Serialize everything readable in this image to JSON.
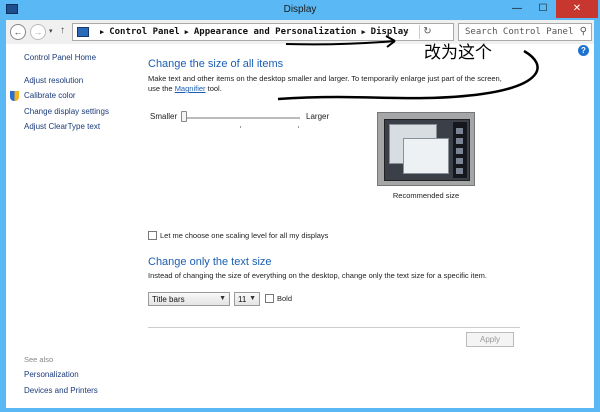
{
  "window": {
    "title": "Display"
  },
  "titlebar": {
    "minimize": "—",
    "maximize": "☐",
    "close": "✕"
  },
  "nav": {
    "back": "←",
    "forward": "→",
    "up": "↑",
    "crumbs": [
      "Control Panel",
      "Appearance and Personalization",
      "Display"
    ],
    "search_placeholder": "Search Control Panel"
  },
  "sidebar": {
    "home": "Control Panel Home",
    "items": [
      "Adjust resolution",
      "Calibrate color",
      "Change display settings",
      "Adjust ClearType text"
    ],
    "see_also_label": "See also",
    "see_also": [
      "Personalization",
      "Devices and Printers"
    ]
  },
  "size_section": {
    "title": "Change the size of all items",
    "line1": "Make text and other items on the desktop smaller and larger. To temporarily enlarge just part of the screen,",
    "line2_prefix": "use the ",
    "line2_link": "Magnifier",
    "line2_suffix": " tool.",
    "slider_min_label": "Smaller",
    "slider_max_label": "Larger",
    "slider_value": 0,
    "preview_caption": "Recommended size",
    "scaling_checkbox_label": "Let me choose one scaling level for all my displays",
    "scaling_checked": false
  },
  "text_section": {
    "title": "Change only the text size",
    "description": "Instead of changing the size of everything on the desktop, change only the text size for a specific item.",
    "item_select": "Title bars",
    "size_select": "11",
    "bold_label": "Bold",
    "bold_checked": false
  },
  "apply_label": "Apply",
  "annotation": {
    "text": "改为这个"
  },
  "colors": {
    "titlebar": "#5ab8f5",
    "link": "#1a5fb4",
    "close": "#c7372f"
  }
}
